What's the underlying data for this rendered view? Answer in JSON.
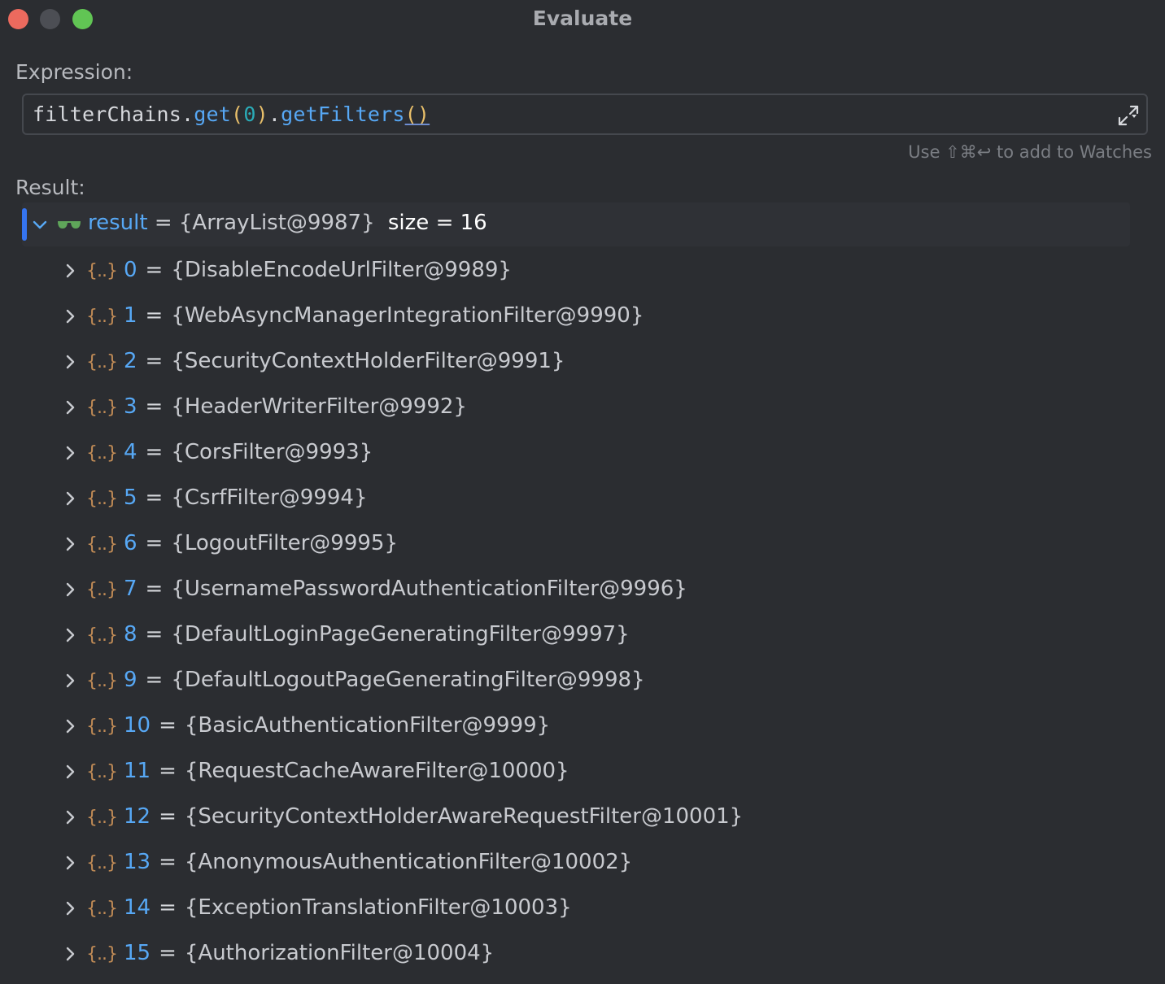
{
  "window": {
    "title": "Evaluate"
  },
  "expression": {
    "label": "Expression:",
    "code": {
      "object": "filterChains",
      "dot1": ".",
      "method1": "get",
      "open1": "(",
      "arg1": "0",
      "close1": ")",
      "dot2": ".",
      "method2": "getFilters",
      "parens2": "()"
    },
    "hint": "Use ⇧⌘↩ to add to Watches"
  },
  "result": {
    "label": "Result:",
    "root": {
      "name": "result",
      "equals": "=",
      "value": "{ArrayList@9987}",
      "size": "size = 16"
    },
    "items": [
      {
        "icon": "{..}",
        "index": "0",
        "value": "{DisableEncodeUrlFilter@9989}"
      },
      {
        "icon": "{..}",
        "index": "1",
        "value": "{WebAsyncManagerIntegrationFilter@9990}"
      },
      {
        "icon": "{..}",
        "index": "2",
        "value": "{SecurityContextHolderFilter@9991}"
      },
      {
        "icon": "{..}",
        "index": "3",
        "value": "{HeaderWriterFilter@9992}"
      },
      {
        "icon": "{..}",
        "index": "4",
        "value": "{CorsFilter@9993}"
      },
      {
        "icon": "{..}",
        "index": "5",
        "value": "{CsrfFilter@9994}"
      },
      {
        "icon": "{..}",
        "index": "6",
        "value": "{LogoutFilter@9995}"
      },
      {
        "icon": "{..}",
        "index": "7",
        "value": "{UsernamePasswordAuthenticationFilter@9996}"
      },
      {
        "icon": "{..}",
        "index": "8",
        "value": "{DefaultLoginPageGeneratingFilter@9997}"
      },
      {
        "icon": "{..}",
        "index": "9",
        "value": "{DefaultLogoutPageGeneratingFilter@9998}"
      },
      {
        "icon": "{..}",
        "index": "10",
        "value": "{BasicAuthenticationFilter@9999}"
      },
      {
        "icon": "{..}",
        "index": "11",
        "value": "{RequestCacheAwareFilter@10000}"
      },
      {
        "icon": "{..}",
        "index": "12",
        "value": "{SecurityContextHolderAwareRequestFilter@10001}"
      },
      {
        "icon": "{..}",
        "index": "13",
        "value": "{AnonymousAuthenticationFilter@10002}"
      },
      {
        "icon": "{..}",
        "index": "14",
        "value": "{ExceptionTranslationFilter@10003}"
      },
      {
        "icon": "{..}",
        "index": "15",
        "value": "{AuthorizationFilter@10004}"
      }
    ],
    "equals": "="
  },
  "colors": {
    "background": "#2b2d31",
    "accent": "#3574f0",
    "name_blue": "#57a8f5",
    "object_icon": "#c08b56",
    "watch_icon": "#5fa55a"
  }
}
